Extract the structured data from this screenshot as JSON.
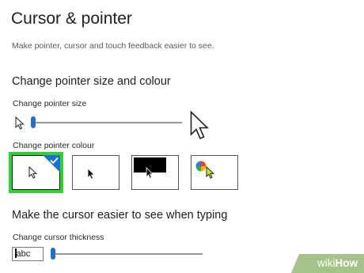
{
  "page": {
    "title": "Cursor & pointer",
    "subtitle": "Make pointer, cursor and touch feedback easier to see."
  },
  "pointer_size": {
    "heading": "Change pointer size and colour",
    "label": "Change pointer size",
    "slider_level": 0.0,
    "small_icon": "small-arrow-pointer-icon",
    "large_icon": "large-arrow-pointer-icon"
  },
  "pointer_colour": {
    "label": "Change pointer colour",
    "selected_index": 0,
    "options": [
      {
        "name": "white",
        "icon": "white-pointer-icon"
      },
      {
        "name": "black",
        "icon": "black-pointer-icon"
      },
      {
        "name": "inverted",
        "icon": "inverted-pointer-icon"
      },
      {
        "name": "custom",
        "icon": "custom-colour-pointer-icon"
      }
    ],
    "checkmark_icon": "checkmark-icon",
    "selected_border_color": "#2fd22f",
    "accent": "#1f6fd1"
  },
  "cursor": {
    "heading": "Make the cursor easier to see when typing",
    "label": "Change cursor thickness",
    "preview_text": "abc",
    "slider_level": 0.0
  },
  "watermark": {
    "brand_prefix": "wiki",
    "brand_suffix": "How",
    "color": "#93b873"
  }
}
